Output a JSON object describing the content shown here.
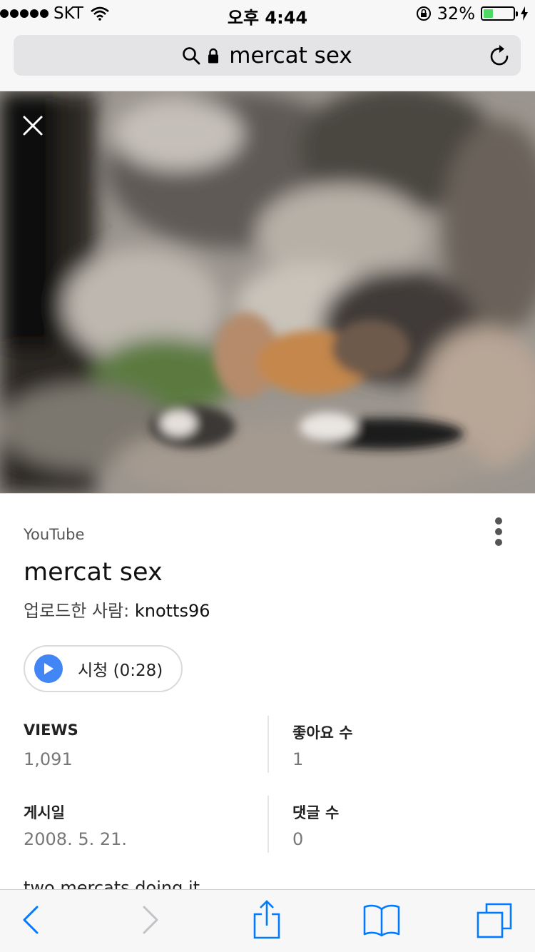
{
  "status_bar": {
    "carrier": "SKT",
    "time": "오후 4:44",
    "battery_percent": "32%",
    "battery_level": 0.32,
    "signal_bars": 5
  },
  "address_bar": {
    "text": "mercat sex",
    "icons": [
      "search-icon",
      "lock-icon",
      "reload-icon"
    ]
  },
  "result": {
    "source": "YouTube",
    "title": "mercat sex",
    "uploader_label": "업로드한 사람: ",
    "uploader_name": "knotts96",
    "watch_label": "시청 (0:28)",
    "stats": [
      {
        "label": "VIEWS",
        "value": "1,091"
      },
      {
        "label": "좋아요 수",
        "value": "1"
      },
      {
        "label": "게시일",
        "value": "2008. 5. 21."
      },
      {
        "label": "댓글 수",
        "value": "0"
      }
    ],
    "description": "two mercats doing it"
  },
  "toolbar": {
    "icons": [
      "back-icon",
      "forward-icon",
      "share-icon",
      "bookmarks-icon",
      "tabs-icon"
    ]
  },
  "colors": {
    "accent": "#007aff",
    "play": "#4285f4",
    "battery": "#4cd964"
  }
}
